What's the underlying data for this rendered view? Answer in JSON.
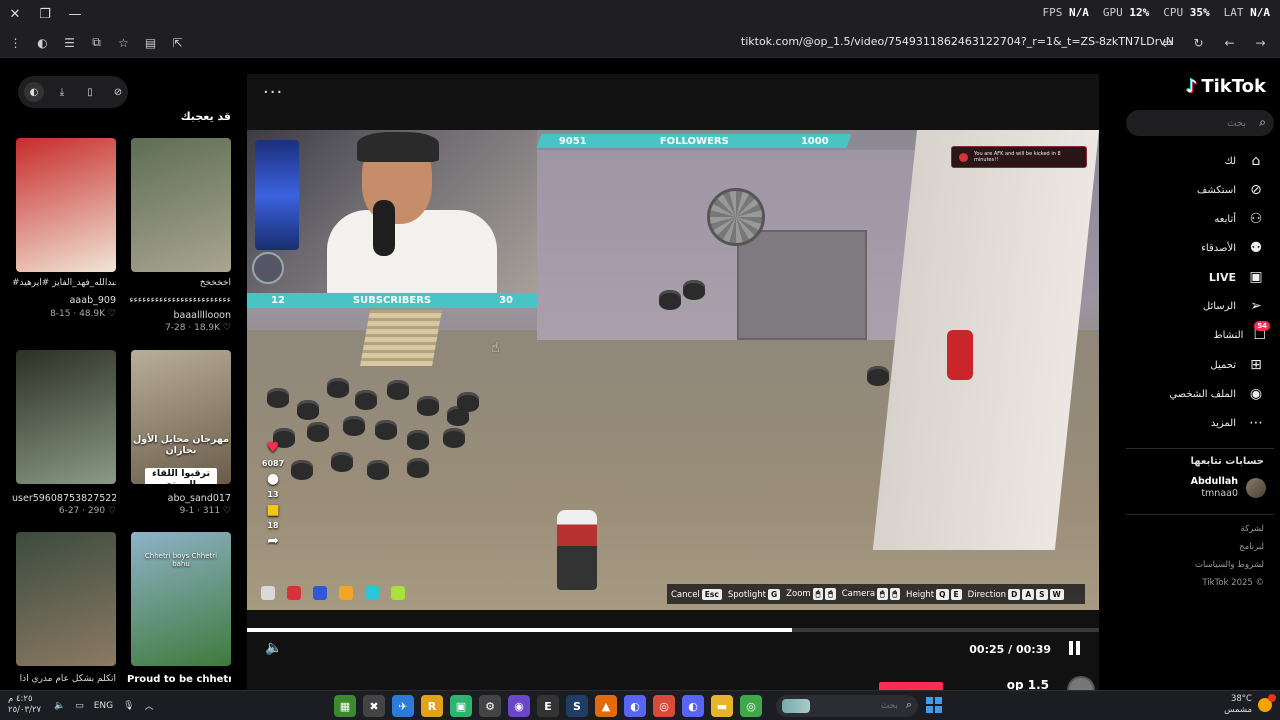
{
  "window": {
    "close_glyph": "✕",
    "restore_glyph": "❐",
    "minimize_glyph": "—",
    "tab_hint": "✕  ●  ⋯"
  },
  "overlay": {
    "fps_label": "FPS",
    "fps_value": "N/A",
    "gpu_label": "GPU",
    "gpu_value": "12%",
    "cpu_label": "CPU",
    "cpu_value": "35%",
    "lat_label": "LAT",
    "lat_value": "N/A"
  },
  "browser": {
    "url": "tiktok.com/@op_1.5/video/7549311862463122704?_r=1&_t=ZS-8zkTN7LDrvN"
  },
  "left": {
    "heading": "قد يعجبك",
    "videos": [
      {
        "title": "#عبدالله_فهد_الفايز #ايرهيد",
        "author": "aaab_909",
        "date": "8-15",
        "views": "48.9K",
        "colors": [
          "#c72b2b",
          "#f1e6d6"
        ]
      },
      {
        "title": "اخخخخخ",
        "author": "baaallllooon",
        "date": "7-28",
        "views": "18.9K",
        "colors": [
          "#5e6d54",
          "#a9a592"
        ],
        "subtitle": "ءءءءءءءءءءءءءءءءءءءءءءءء"
      },
      {
        "title": "",
        "author": "user59608753827522",
        "date": "6-27",
        "views": "290",
        "colors": [
          "#2c3024",
          "#8b9a86"
        ]
      },
      {
        "title": "",
        "author": "abo_sand017",
        "date": "9-1",
        "views": "311",
        "colors": [
          "#b9ae9a",
          "#6a5c48"
        ],
        "caption_top": "مهرجان محايل الأول بجازان",
        "caption_bottom": "ترقبوا اللقاء الممتع"
      },
      {
        "title": "اتكلم بشكل عام مدري اذا",
        "author": "",
        "date": "",
        "views": "",
        "colors": [
          "#3b4b3e",
          "#8c7a64"
        ]
      },
      {
        "title": "Proud to be chhetri",
        "author": "",
        "date": "",
        "views": "",
        "colors": [
          "#8fb2c9",
          "#3f7a3c"
        ],
        "caption_top": "Chhetri boys Chhetri bahu",
        "caption_bottom": ""
      }
    ]
  },
  "player": {
    "menu_glyph": "···",
    "followers_current": "9051",
    "followers_label": "FOLLOWERS",
    "followers_goal": "1000",
    "subscribers_current": "12",
    "subscribers_label": "SUBSCRIBERS",
    "subscribers_goal": "30",
    "afk_text": "You are AFK and will be kicked in 8 minutes!!",
    "like_count": "6087",
    "comment_count": "13",
    "save_count": "18",
    "hud": [
      {
        "label": "Cancel",
        "keys": [
          "Esc"
        ]
      },
      {
        "label": "Spotlight",
        "keys": [
          "G"
        ]
      },
      {
        "label": "Zoom",
        "keys": [
          "🖱",
          "🖱"
        ]
      },
      {
        "label": "Camera",
        "keys": [
          "🖱",
          "🖱"
        ]
      },
      {
        "label": "Height",
        "keys": [
          "Q",
          "E"
        ]
      },
      {
        "label": "Direction",
        "keys": [
          "D",
          "A",
          "S",
          "W"
        ]
      }
    ],
    "hud_dot_colors": [
      "#d9d9d9",
      "#d8323a",
      "#2f58d8",
      "#f2a422",
      "#2fc5d8",
      "#a8e03c"
    ],
    "current_time": "00:25",
    "duration": "00:39",
    "progress_fraction": 0.64,
    "next_author": "op 1.5"
  },
  "right": {
    "brand": "TikTok",
    "search_placeholder": "بحث",
    "nav": [
      {
        "label": "لك",
        "icon": "⌂",
        "name": "home"
      },
      {
        "label": "استكشف",
        "icon": "⊘",
        "name": "explore"
      },
      {
        "label": "أتابعه",
        "icon": "⚇",
        "name": "following"
      },
      {
        "label": "الأصدقاء",
        "icon": "⚉",
        "name": "friends"
      },
      {
        "label": "LIVE",
        "icon": "▣",
        "name": "live"
      },
      {
        "label": "الرسائل",
        "icon": "➢",
        "name": "messages"
      },
      {
        "label": "النشاط",
        "icon": "☐",
        "name": "activity",
        "badge": "54"
      },
      {
        "label": "تحميل",
        "icon": "⊞",
        "name": "upload"
      },
      {
        "label": "الملف الشخصي",
        "icon": "◉",
        "name": "profile"
      },
      {
        "label": "المزيد",
        "icon": "⋯",
        "name": "more"
      }
    ],
    "following_title": "حسابات تتابعها",
    "following_account": {
      "name": "Abdullah",
      "handle": "tmnaa0"
    },
    "footer": [
      "لشركة",
      "لبرنامج",
      "لشروط والسياسات",
      "TikTok 2025 ©"
    ]
  },
  "taskbar": {
    "time": "٤:٢٥ م",
    "date": "٢٥/٠٣/٢٧",
    "lang": "ENG",
    "search_placeholder": "بحث",
    "weather_temp": "38°C",
    "weather_text": "مشمس",
    "apps": [
      {
        "name": "minecraft",
        "glyph": "▦",
        "color": "#3c8a2e"
      },
      {
        "name": "tool",
        "glyph": "✖",
        "color": "#444"
      },
      {
        "name": "messenger",
        "glyph": "✈",
        "color": "#2b7bd8"
      },
      {
        "name": "rockstar",
        "glyph": "R",
        "color": "#e4a11b"
      },
      {
        "name": "android",
        "glyph": "▣",
        "color": "#2fb36f"
      },
      {
        "name": "settings",
        "glyph": "⚙",
        "color": "#444"
      },
      {
        "name": "discord-alt",
        "glyph": "◉",
        "color": "#6a46c8"
      },
      {
        "name": "epic",
        "glyph": "E",
        "color": "#333"
      },
      {
        "name": "steam",
        "glyph": "S",
        "color": "#1f3e66"
      },
      {
        "name": "vlc",
        "glyph": "▲",
        "color": "#e36b0c"
      },
      {
        "name": "discord",
        "glyph": "◐",
        "color": "#5865f2"
      },
      {
        "name": "chrome-active",
        "glyph": "◎",
        "color": "#d84a3a"
      },
      {
        "name": "discord2",
        "glyph": "◐",
        "color": "#5865f2"
      },
      {
        "name": "explorer",
        "glyph": "▬",
        "color": "#e7b42c"
      },
      {
        "name": "chrome",
        "glyph": "◎",
        "color": "#3ea84a"
      }
    ]
  }
}
